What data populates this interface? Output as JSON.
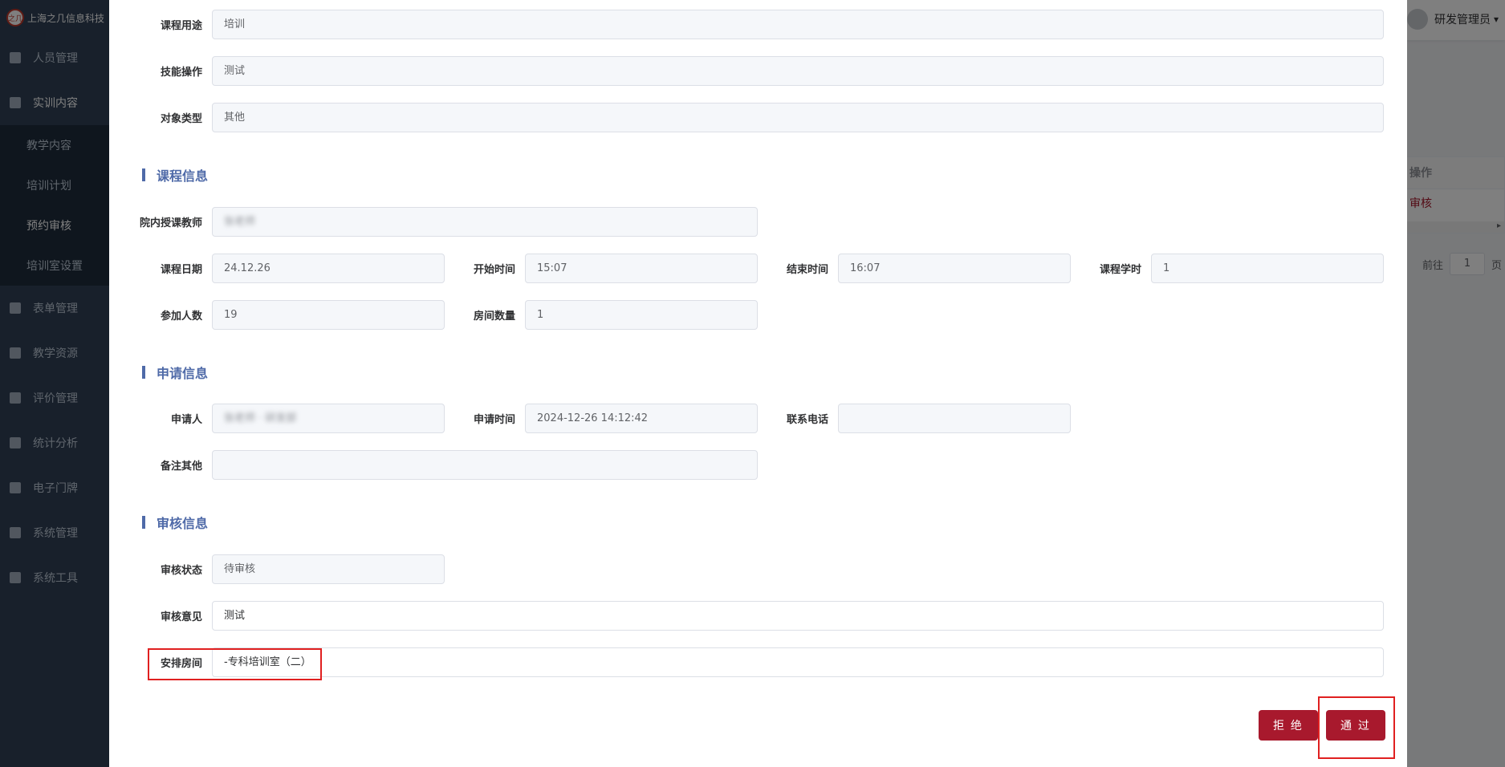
{
  "app": {
    "company_name": "上海之几信息科技",
    "logo_mark": "之几",
    "user_name": "研发管理员",
    "caret": "▾"
  },
  "sidebar": {
    "items": [
      {
        "label": "人员管理",
        "icon": "user-icon"
      },
      {
        "label": "实训内容",
        "icon": "content-icon"
      },
      {
        "label": "表单管理",
        "icon": "form-icon"
      },
      {
        "label": "教学资源",
        "icon": "resource-icon"
      },
      {
        "label": "评价管理",
        "icon": "evaluation-icon"
      },
      {
        "label": "统计分析",
        "icon": "chart-icon"
      },
      {
        "label": "电子门牌",
        "icon": "monitor-icon"
      },
      {
        "label": "系统管理",
        "icon": "gear-icon"
      },
      {
        "label": "系统工具",
        "icon": "toolbox-icon"
      }
    ],
    "submenu": [
      {
        "label": "教学内容"
      },
      {
        "label": "培训计划"
      },
      {
        "label": "预约审核"
      },
      {
        "label": "培训室设置"
      }
    ]
  },
  "bg_table": {
    "header": "操作",
    "action": "审核",
    "scroll_arrow": "▸"
  },
  "bg_pager": {
    "goto_label": "前往",
    "page": "1",
    "page_suffix": "页"
  },
  "form": {
    "course_use": {
      "label": "课程用途",
      "value": "培训"
    },
    "skill_op": {
      "label": "技能操作",
      "value": "测试"
    },
    "object_type": {
      "label": "对象类型",
      "value": "其他"
    },
    "sections": {
      "course_info": "课程信息",
      "apply_info": "申请信息",
      "review_info": "审核信息"
    },
    "teacher": {
      "label": "院内授课教师",
      "value": "张老师"
    },
    "course_date": {
      "label": "课程日期",
      "value": "24.12.26"
    },
    "start_time": {
      "label": "开始时间",
      "value": "15:07"
    },
    "end_time": {
      "label": "结束时间",
      "value": "16:07"
    },
    "course_hours": {
      "label": "课程学时",
      "value": "1"
    },
    "participants": {
      "label": "参加人数",
      "value": "19"
    },
    "room_count": {
      "label": "房间数量",
      "value": "1"
    },
    "applicant": {
      "label": "申请人",
      "value": "张老师 · 研发部"
    },
    "apply_time": {
      "label": "申请时间",
      "value": "2024-12-26 14:12:42"
    },
    "phone": {
      "label": "联系电话",
      "value": ""
    },
    "remarks": {
      "label": "备注其他",
      "value": ""
    },
    "review_status": {
      "label": "审核状态",
      "value": "待审核"
    },
    "review_opinion": {
      "label": "审核意见",
      "value": "测试"
    },
    "arrange_room": {
      "label": "安排房间",
      "value": "-专科培训室（二）"
    }
  },
  "buttons": {
    "reject": "拒 绝",
    "approve": "通 过"
  },
  "colors": {
    "brand_red": "#a8192d",
    "section_blue": "#4f6aa8",
    "highlight": "#e02020"
  }
}
